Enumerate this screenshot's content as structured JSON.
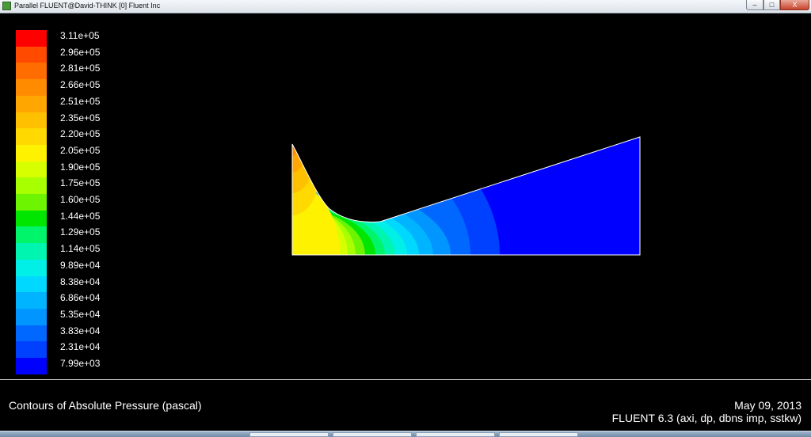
{
  "window": {
    "title": "Parallel FLUENT@David-THINK [0] Fluent Inc",
    "buttons": {
      "minimize": "–",
      "maximize": "□",
      "close": "X"
    },
    "icons": {
      "app": "fluent-app-icon"
    }
  },
  "legend": {
    "levels": [
      {
        "label": "3.11e+05",
        "color": "#ff0000"
      },
      {
        "label": "2.96e+05",
        "color": "#ff4a00"
      },
      {
        "label": "2.81e+05",
        "color": "#ff6c00"
      },
      {
        "label": "2.66e+05",
        "color": "#ff8c00"
      },
      {
        "label": "2.51e+05",
        "color": "#ffa700"
      },
      {
        "label": "2.35e+05",
        "color": "#ffc000"
      },
      {
        "label": "2.20e+05",
        "color": "#ffd900"
      },
      {
        "label": "2.05e+05",
        "color": "#fff200"
      },
      {
        "label": "1.90e+05",
        "color": "#d7ff00"
      },
      {
        "label": "1.75e+05",
        "color": "#a8ff00"
      },
      {
        "label": "1.60e+05",
        "color": "#6cf400"
      },
      {
        "label": "1.44e+05",
        "color": "#00e600"
      },
      {
        "label": "1.29e+05",
        "color": "#00f56b"
      },
      {
        "label": "1.14e+05",
        "color": "#00f5b0"
      },
      {
        "label": "9.89e+04",
        "color": "#00f0e8"
      },
      {
        "label": "8.38e+04",
        "color": "#00d8ff"
      },
      {
        "label": "6.86e+04",
        "color": "#00b4ff"
      },
      {
        "label": "5.35e+04",
        "color": "#0095ff"
      },
      {
        "label": "3.83e+04",
        "color": "#0068ff"
      },
      {
        "label": "2.31e+04",
        "color": "#0040ff"
      },
      {
        "label": "7.99e+03",
        "color": "#0000ff"
      }
    ]
  },
  "info": {
    "caption": "Contours of Absolute Pressure (pascal)",
    "date": "May 09, 2013",
    "version": "FLUENT 6.3 (axi, dp, dbns imp, sstkw)"
  }
}
